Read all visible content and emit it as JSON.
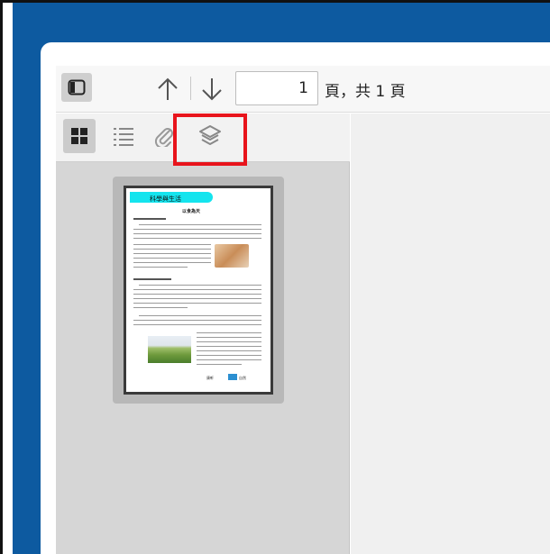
{
  "toolbar": {
    "sidebar_toggle_icon": "sidebar-toggle-icon",
    "prev_icon": "arrow-up-icon",
    "next_icon": "arrow-down-icon",
    "page_input_value": "1",
    "page_count_text": "頁，共 1 頁"
  },
  "sidebar": {
    "tabs": [
      {
        "icon": "thumbnails-icon",
        "active": true
      },
      {
        "icon": "outline-icon",
        "active": false
      },
      {
        "icon": "attachments-icon",
        "active": false
      },
      {
        "icon": "layers-icon",
        "active": false,
        "highlighted": true
      }
    ],
    "thumbnail": {
      "header": "科學與生活",
      "title": "以食為天",
      "logo_left": "康軒",
      "logo_right": "自然"
    }
  },
  "colors": {
    "frame_blue": "#0d5aa0",
    "highlight_red": "#e8141c",
    "thumb_header_cyan": "#14e4ee"
  }
}
